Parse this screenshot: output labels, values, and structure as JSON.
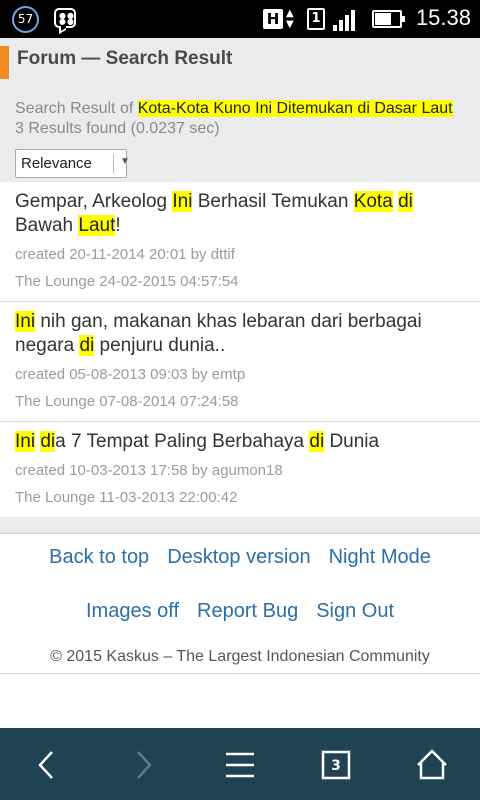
{
  "status_bar": {
    "notification_count": "57",
    "network_type": "H",
    "sim_label": "1",
    "battery_level": 0.6,
    "time": "15.38",
    "icons": [
      "bbm-icon",
      "network-arrows-icon",
      "signal-icon",
      "battery-icon"
    ]
  },
  "header": {
    "title": "Forum — Search Result",
    "summary_prefix": "Search Result of ",
    "query": "Kota-Kota Kuno Ini Ditemukan di Dasar Laut",
    "summary_suffix": " 3 Results found (0.0237 sec)",
    "sort_selected": "Relevance",
    "accent_color": "#f58a1f"
  },
  "results": [
    {
      "title_parts": [
        {
          "t": "Gempar, Arkeolog ",
          "hl": false
        },
        {
          "t": "Ini",
          "hl": true
        },
        {
          "t": " Berhasil Temukan ",
          "hl": false
        },
        {
          "t": "Kota",
          "hl": true
        },
        {
          "t": " ",
          "hl": false
        },
        {
          "t": "di",
          "hl": true
        },
        {
          "t": " Bawah ",
          "hl": false
        },
        {
          "t": "Laut",
          "hl": true
        },
        {
          "t": "!",
          "hl": false
        }
      ],
      "meta": "created 20-11-2014 20:01 by dttif",
      "forum": "The Lounge 24-02-2015 04:57:54"
    },
    {
      "title_parts": [
        {
          "t": "Ini",
          "hl": true
        },
        {
          "t": " nih gan, makanan khas lebaran dari berbagai negara ",
          "hl": false
        },
        {
          "t": "di",
          "hl": true
        },
        {
          "t": " penjuru dunia..",
          "hl": false
        }
      ],
      "meta": "created 05-08-2013 09:03 by emtp",
      "forum": "The Lounge 07-08-2014 07:24:58"
    },
    {
      "title_parts": [
        {
          "t": "Ini",
          "hl": true
        },
        {
          "t": " ",
          "hl": false
        },
        {
          "t": "di",
          "hl": true
        },
        {
          "t": "a 7 Tempat Paling Berbahaya ",
          "hl": false
        },
        {
          "t": "di",
          "hl": true
        },
        {
          "t": " Dunia",
          "hl": false
        }
      ],
      "meta": "created 10-03-2013 17:58 by agumon18",
      "forum": "The Lounge 11-03-2013 22:00:42"
    }
  ],
  "footer": {
    "back_to_top": "Back to top",
    "desktop_version": "Desktop version",
    "night_mode": "Night Mode",
    "images_off": "Images off",
    "report_bug": "Report Bug",
    "sign_out": "Sign Out",
    "copyright": "© 2015 Kaskus – The Largest Indonesian Community",
    "link_color": "#2a6fa8"
  },
  "navbar": {
    "tab_count": "3",
    "icons": [
      "back-icon",
      "forward-icon",
      "menu-icon",
      "tabs-icon",
      "home-icon"
    ]
  }
}
